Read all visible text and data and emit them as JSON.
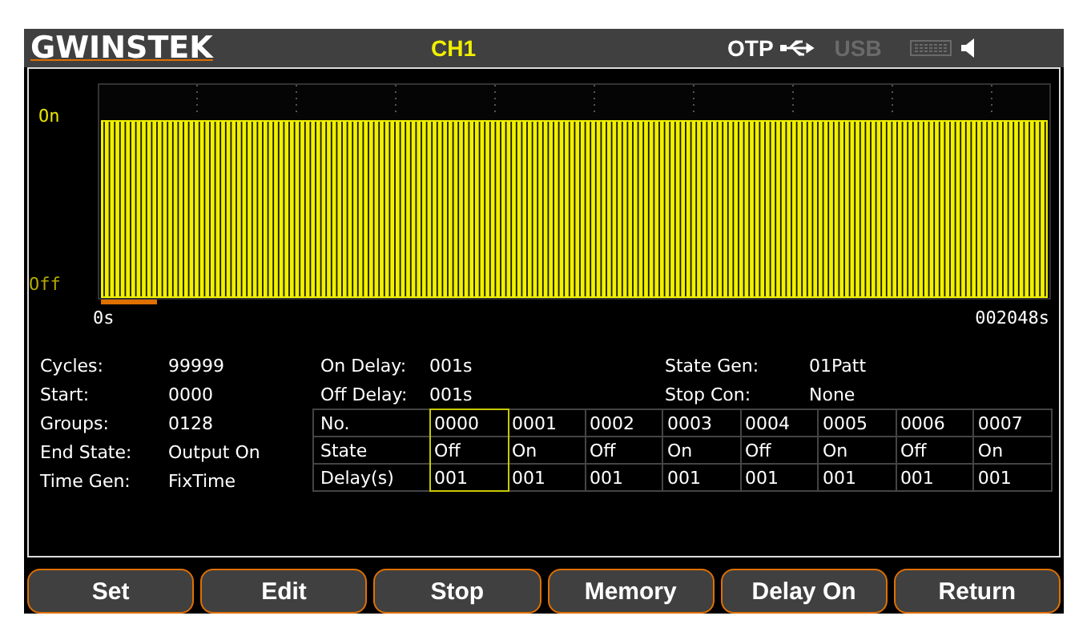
{
  "header": {
    "logo": "GWINSTEK",
    "channel": "CH1",
    "otp": "OTP",
    "usb": {
      "label": "USB",
      "disabled": true
    }
  },
  "plot": {
    "y_high": "On",
    "y_low": "Off",
    "x_start": "0s",
    "x_end": "002048s",
    "progress": {
      "level": 0.06
    }
  },
  "settings_left": [
    {
      "label": "Cycles:",
      "value": "99999"
    },
    {
      "label": "Start:",
      "value": "0000"
    },
    {
      "label": "Groups:",
      "value": "0128"
    },
    {
      "label": "End State:",
      "value": "Output On"
    },
    {
      "label": "Time Gen:",
      "value": "FixTime"
    }
  ],
  "settings_mid": [
    {
      "label": "On Delay:",
      "value": "001s"
    },
    {
      "label": "Off Delay:",
      "value": "001s"
    }
  ],
  "settings_right": [
    {
      "label": "State Gen:",
      "value": "01Patt"
    },
    {
      "label": "Stop Con:",
      "value": "None"
    }
  ],
  "table": {
    "row_labels": [
      "No.",
      "State",
      "Delay(s)"
    ],
    "steps": [
      {
        "no": "0000",
        "state": "Off",
        "delay": "001",
        "selected": true
      },
      {
        "no": "0001",
        "state": "On",
        "delay": "001",
        "selected": false
      },
      {
        "no": "0002",
        "state": "Off",
        "delay": "001",
        "selected": false
      },
      {
        "no": "0003",
        "state": "On",
        "delay": "001",
        "selected": false
      },
      {
        "no": "0004",
        "state": "Off",
        "delay": "001",
        "selected": false
      },
      {
        "no": "0005",
        "state": "On",
        "delay": "001",
        "selected": false
      },
      {
        "no": "0006",
        "state": "Off",
        "delay": "001",
        "selected": false
      },
      {
        "no": "0007",
        "state": "On",
        "delay": "001",
        "selected": false
      }
    ]
  },
  "softkeys": [
    "Set",
    "Edit",
    "Stop",
    "Memory",
    "Delay On",
    "Return"
  ]
}
